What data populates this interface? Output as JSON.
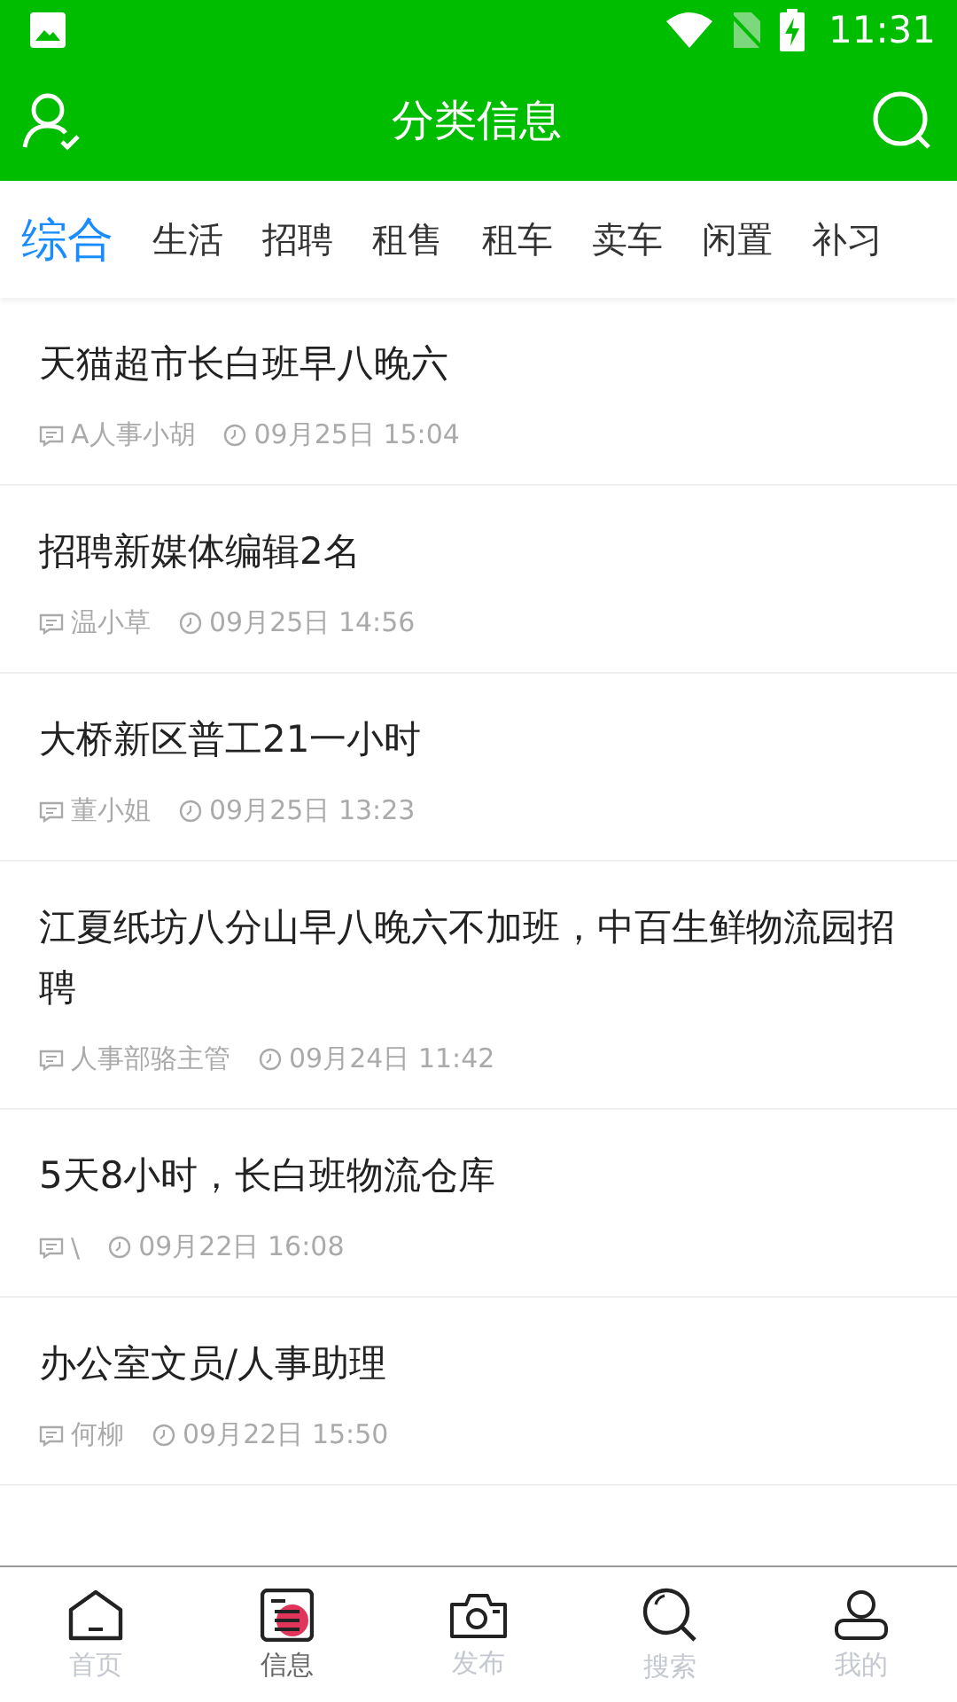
{
  "status_bar": {
    "time": "11:31"
  },
  "header": {
    "title": "分类信息"
  },
  "tabs": [
    {
      "label": "综合",
      "selected": true
    },
    {
      "label": "生活",
      "selected": false
    },
    {
      "label": "招聘",
      "selected": false
    },
    {
      "label": "租售",
      "selected": false
    },
    {
      "label": "租车",
      "selected": false
    },
    {
      "label": "卖车",
      "selected": false
    },
    {
      "label": "闲置",
      "selected": false
    },
    {
      "label": "补习",
      "selected": false
    }
  ],
  "posts": [
    {
      "title": "天猫超市长白班早八晚六",
      "author": "A人事小胡",
      "time": "09月25日 15:04"
    },
    {
      "title": "招聘新媒体编辑2名",
      "author": "温小草",
      "time": "09月25日 14:56"
    },
    {
      "title": "大桥新区普工21一小时",
      "author": "董小姐",
      "time": "09月25日 13:23"
    },
    {
      "title": "江夏纸坊八分山早八晚六不加班，中百生鲜物流园招聘",
      "author": "人事部骆主管",
      "time": "09月24日 11:42"
    },
    {
      "title": "5天8小时，长白班物流仓库",
      "author": "\\",
      "time": "09月22日 16:08"
    },
    {
      "title": "办公室文员/人事助理",
      "author": "何柳",
      "time": "09月22日 15:50"
    }
  ],
  "bottom_nav": [
    {
      "label": "首页",
      "kind": "home",
      "selected": false
    },
    {
      "label": "信息",
      "kind": "info",
      "selected": true
    },
    {
      "label": "发布",
      "kind": "camera",
      "selected": false
    },
    {
      "label": "搜索",
      "kind": "search",
      "selected": false
    },
    {
      "label": "我的",
      "kind": "profile",
      "selected": false
    }
  ]
}
